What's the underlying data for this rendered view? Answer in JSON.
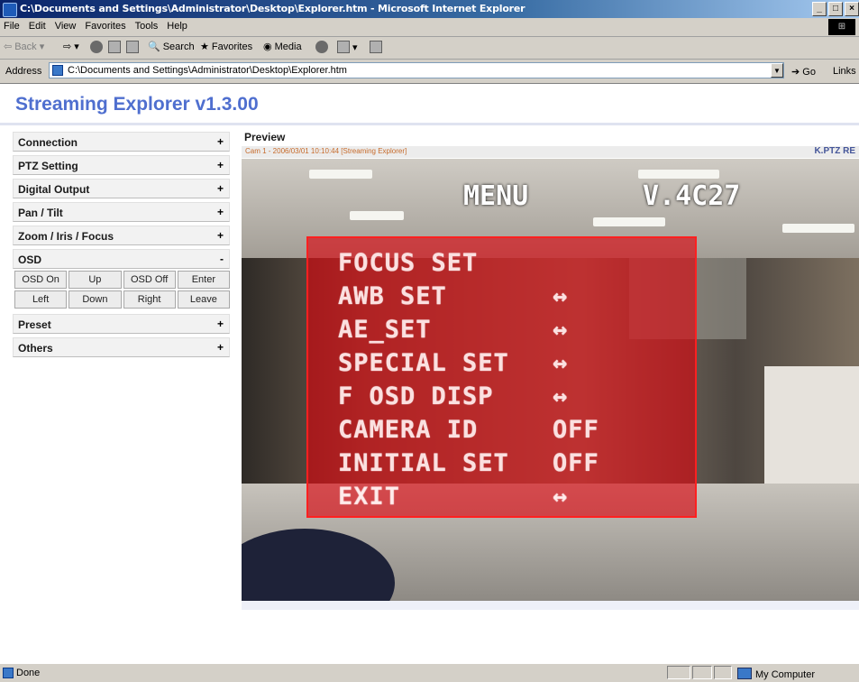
{
  "window": {
    "title": "C:\\Documents and Settings\\Administrator\\Desktop\\Explorer.htm - Microsoft Internet Explorer",
    "buttons": [
      "_",
      "□",
      "×"
    ]
  },
  "menubar": {
    "items": [
      "File",
      "Edit",
      "View",
      "Favorites",
      "Tools",
      "Help"
    ]
  },
  "toolbar": {
    "back": "Back",
    "search": "Search",
    "favorites": "Favorites",
    "media": "Media"
  },
  "address": {
    "label": "Address",
    "url": "C:\\Documents and Settings\\Administrator\\Desktop\\Explorer.htm",
    "go": "Go",
    "links": "Links"
  },
  "app": {
    "title": "Streaming Explorer v1.3.00"
  },
  "sidebar": {
    "sections": [
      {
        "label": "Connection",
        "toggle": "+"
      },
      {
        "label": "PTZ Setting",
        "toggle": "+"
      },
      {
        "label": "Digital Output",
        "toggle": "+"
      },
      {
        "label": "Pan / Tilt",
        "toggle": "+"
      },
      {
        "label": "Zoom / Iris / Focus",
        "toggle": "+"
      },
      {
        "label": "OSD",
        "toggle": "-"
      },
      {
        "label": "Preset",
        "toggle": "+"
      },
      {
        "label": "Others",
        "toggle": "+"
      }
    ],
    "osd_buttons": [
      "OSD On",
      "Up",
      "OSD Off",
      "Enter",
      "Left",
      "Down",
      "Right",
      "Leave"
    ]
  },
  "preview": {
    "label": "Preview",
    "camera_info": "Cam 1 - 2006/03/01 10:10:44 [Streaming Explorer]",
    "brand": "K.PTZ RE"
  },
  "camera_osd": {
    "menu_title": "MENU",
    "version": "V.4C27",
    "items": [
      {
        "label": "FOCUS SET",
        "value": ""
      },
      {
        "label": "AWB SET",
        "value": "↔"
      },
      {
        "label": "AE_SET",
        "value": "↔"
      },
      {
        "label": "SPECIAL SET",
        "value": "↔"
      },
      {
        "label": "F OSD DISP",
        "value": "↔"
      },
      {
        "label": "CAMERA ID",
        "value": "OFF"
      },
      {
        "label": "INITIAL SET",
        "value": "OFF"
      },
      {
        "label": "EXIT",
        "value": "↔"
      }
    ]
  },
  "status": {
    "left": "Done",
    "zone": "My Computer"
  }
}
